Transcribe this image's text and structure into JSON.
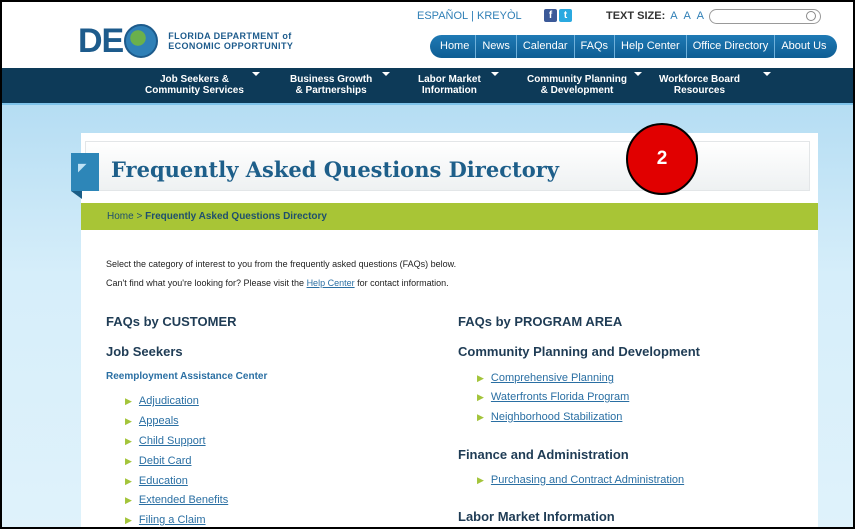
{
  "header": {
    "logo_text": "DE",
    "org_line1": "FLORIDA DEPARTMENT of",
    "org_line2": "ECONOMIC OPPORTUNITY",
    "lang_es": "ESPAÑOL",
    "lang_sep": "|",
    "lang_kr": "KREYÒL",
    "fb_icon": "f",
    "tw_icon": "t",
    "text_size_label": "TEXT SIZE:",
    "text_size_options": "A A A",
    "search_placeholder": "",
    "topnav": [
      "Home",
      "News",
      "Calendar",
      "FAQs",
      "Help Center",
      "Office Directory",
      "About Us"
    ]
  },
  "mainnav": {
    "items": [
      {
        "line1": "Job Seekers &",
        "line2": "Community Services"
      },
      {
        "line1": "Business Growth",
        "line2": "& Partnerships"
      },
      {
        "line1": "Labor Market",
        "line2": "Information"
      },
      {
        "line1": "Community Planning",
        "line2": "& Development"
      },
      {
        "line1": "Workforce Board",
        "line2": "Resources"
      }
    ]
  },
  "page": {
    "title": "Frequently Asked Questions Directory",
    "breadcrumb_home": "Home",
    "breadcrumb_sep": ">",
    "breadcrumb_current": "Frequently Asked Questions Directory",
    "intro_line1": "Select the category of interest to you from the frequently asked questions (FAQs) below.",
    "intro_line2_pre": "Can't find what you're looking for? Please visit the",
    "intro_line2_link": "Help Center",
    "intro_line2_post": "for contact information."
  },
  "left": {
    "heading": "FAQs by CUSTOMER",
    "group": "Job Seekers",
    "subgroup": "Reemployment Assistance Center",
    "items": [
      "Adjudication",
      "Appeals",
      "Child Support",
      "Debit Card",
      "Education",
      "Extended Benefits",
      "Filing a Claim"
    ]
  },
  "right": {
    "heading": "FAQs by PROGRAM AREA",
    "section1": "Community Planning and Development",
    "section1_items": [
      "Comprehensive Planning",
      "Waterfronts Florida Program",
      "Neighborhood Stabilization"
    ],
    "section2": "Finance and Administration",
    "section2_items": [
      "Purchasing and Contract Administration"
    ],
    "section3": "Labor Market Information"
  },
  "annotation": {
    "badge": "2"
  },
  "colors": {
    "nav_dark": "#0d3a58",
    "accent_green": "#a8c536",
    "link_blue": "#2a6fa3",
    "title_blue": "#1e5f8a",
    "badge_red": "#e10000"
  }
}
